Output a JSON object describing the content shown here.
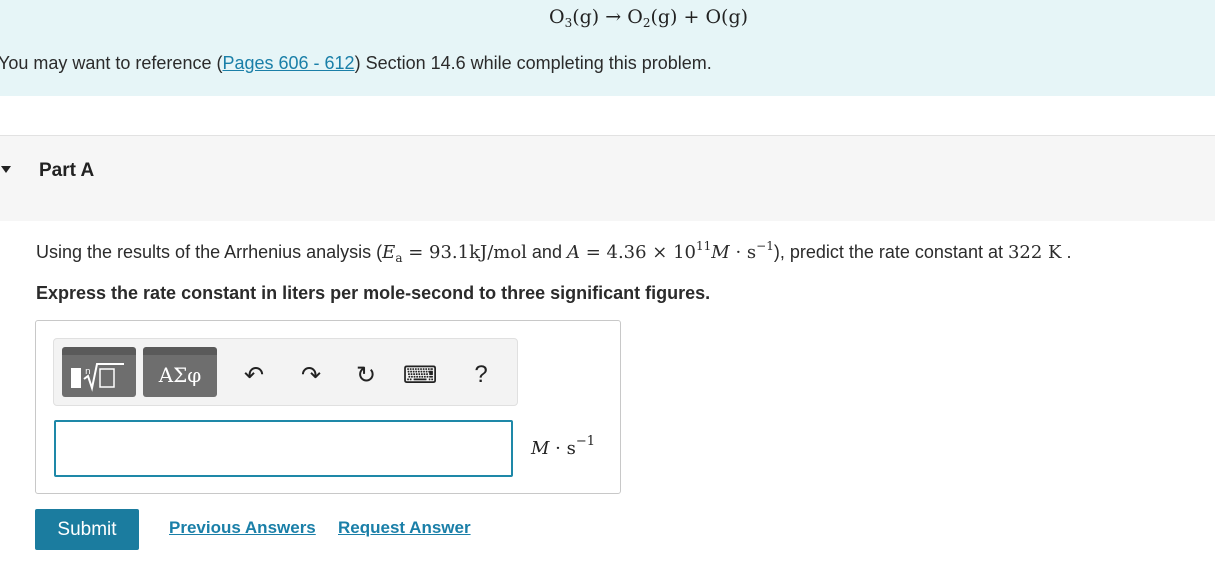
{
  "banner": {
    "reaction": {
      "reactant": "O",
      "reactant_sub": "3",
      "reactant_state": "(g)",
      "arrow": "→",
      "product1": "O",
      "product1_sub": "2",
      "product1_state": "(g)",
      "plus": "+",
      "product2": "O",
      "product2_state": "(g)"
    },
    "reference": {
      "prefix": "You may want to reference (",
      "link_text": "Pages 606 - 612",
      "suffix": ") Section 14.6 while completing this problem."
    }
  },
  "part": {
    "title": "Part A"
  },
  "question": {
    "intro": "Using the results of the Arrhenius analysis (",
    "ea_symbol": "E",
    "ea_sub": "a",
    "ea_value": " = 93.1kJ/mol",
    "and": " and ",
    "a_symbol": "A",
    "a_value": " = 4.36 × 10",
    "a_exp": "11",
    "a_unit_m": "M",
    "a_unit_dot": " · s",
    "a_unit_exp": "−1",
    "mid": "), predict the rate constant at ",
    "temperature": "322 K",
    "end": " .",
    "instruction": "Express the rate constant in liters per mole-second to three significant figures."
  },
  "toolbar": {
    "templates_icon": "sqrt-template-icon",
    "greek_label": "ΑΣφ",
    "undo_glyph": "↶",
    "redo_glyph": "↷",
    "reset_glyph": "↻",
    "keyboard_glyph": "⌨",
    "help_label": "?"
  },
  "answer": {
    "value": "",
    "unit_m": "M",
    "unit_dot": " · s",
    "unit_exp": "−1"
  },
  "actions": {
    "submit": "Submit",
    "previous_answers": "Previous Answers",
    "request_answer": "Request Answer"
  },
  "colors": {
    "banner_bg": "#e6f5f7",
    "link": "#1a7fa8",
    "submit_bg": "#1b7c9f",
    "input_border": "#1e88a8"
  }
}
